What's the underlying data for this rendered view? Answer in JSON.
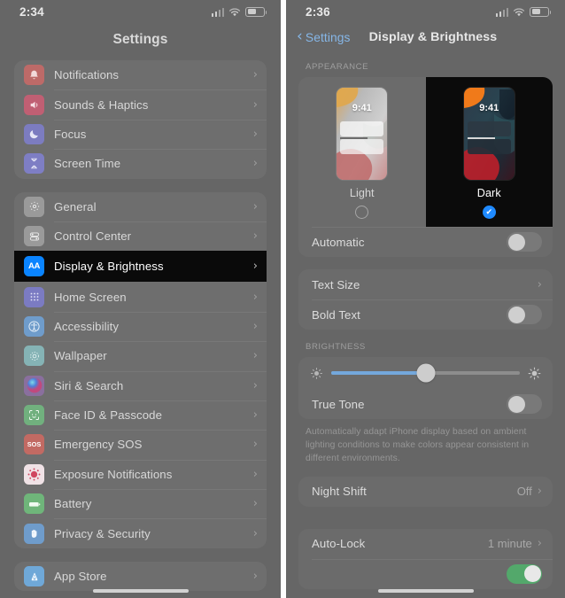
{
  "colors": {
    "panel_bg": "#666666",
    "card_bg": "#6e6e6e",
    "selected_row_bg": "#0a0a0a",
    "accent_blue": "#1f8aff",
    "link_blue": "#86b7e8",
    "slider_fill": "#74a8dc",
    "toggle_on_green": "#53a86b"
  },
  "left_panel": {
    "status_bar": {
      "time": "2:34",
      "cellular": "signal-bars-icon",
      "wifi": "wifi-icon",
      "battery": "battery-icon"
    },
    "title": "Settings",
    "groups": [
      {
        "items": [
          {
            "label": "Notifications",
            "icon": "notifications-icon",
            "icon_bg": "#bd6a68",
            "glyph": "🔔",
            "chevron": "›"
          },
          {
            "label": "Sounds & Haptics",
            "icon": "sounds-icon",
            "icon_bg": "#c05f73",
            "glyph": "🔊",
            "chevron": "›"
          },
          {
            "label": "Focus",
            "icon": "focus-icon",
            "icon_bg": "#7c7cc0",
            "glyph": "🌙",
            "chevron": "›"
          },
          {
            "label": "Screen Time",
            "icon": "screen-time-icon",
            "icon_bg": "#7e7ec4",
            "glyph": "⌛",
            "chevron": "›"
          }
        ]
      },
      {
        "items": [
          {
            "label": "General",
            "icon": "general-gear-icon",
            "icon_bg": "#9a9a9a",
            "glyph": "⚙",
            "chevron": "›",
            "selected": false
          },
          {
            "label": "Control Center",
            "icon": "control-center-icon",
            "icon_bg": "#9a9a9a",
            "glyph": "▤",
            "chevron": "›",
            "selected": false
          },
          {
            "label": "Display & Brightness",
            "icon": "display-brightness-icon",
            "icon_bg": "#0a84ff",
            "glyph": "AA",
            "chevron": "›",
            "selected": true
          },
          {
            "label": "Home Screen",
            "icon": "home-screen-icon",
            "icon_bg": "#7b7bc2",
            "glyph": "∷",
            "chevron": "›",
            "selected": false
          },
          {
            "label": "Accessibility",
            "icon": "accessibility-icon",
            "icon_bg": "#6f9ccb",
            "glyph": "♿",
            "chevron": "›",
            "selected": false
          },
          {
            "label": "Wallpaper",
            "icon": "wallpaper-icon",
            "icon_bg": "#85b3b5",
            "glyph": "❄",
            "chevron": "›",
            "selected": false
          },
          {
            "label": "Siri & Search",
            "icon": "siri-icon",
            "icon_bg": "#8a6f9e",
            "glyph": "◉",
            "chevron": "›",
            "selected": false
          },
          {
            "label": "Face ID & Passcode",
            "icon": "face-id-icon",
            "icon_bg": "#71b07e",
            "glyph": "☺",
            "chevron": "›",
            "selected": false
          },
          {
            "label": "Emergency SOS",
            "icon": "emergency-sos-icon",
            "icon_bg": "#c26a63",
            "glyph": "SOS",
            "chevron": "›",
            "selected": false
          },
          {
            "label": "Exposure Notifications",
            "icon": "exposure-notifications-icon",
            "icon_bg": "#c76f85",
            "glyph": "●",
            "chevron": "›",
            "selected": false
          },
          {
            "label": "Battery",
            "icon": "battery-settings-icon",
            "icon_bg": "#6fb57a",
            "glyph": "▬",
            "chevron": "›",
            "selected": false
          },
          {
            "label": "Privacy & Security",
            "icon": "privacy-security-icon",
            "icon_bg": "#6f9ccb",
            "glyph": "✋",
            "chevron": "›",
            "selected": false
          }
        ]
      },
      {
        "items": [
          {
            "label": "App Store",
            "icon": "app-store-icon",
            "icon_bg": "#6fa8d8",
            "glyph": "A",
            "chevron": "›"
          }
        ]
      }
    ]
  },
  "right_panel": {
    "status_bar": {
      "time": "2:36",
      "cellular": "signal-bars-icon",
      "wifi": "wifi-icon",
      "battery": "battery-icon"
    },
    "back_label": "Settings",
    "title": "Display & Brightness",
    "appearance": {
      "section_label": "APPEARANCE",
      "options": [
        {
          "name": "Light",
          "preview_time": "9:41",
          "selected": false
        },
        {
          "name": "Dark",
          "preview_time": "9:41",
          "selected": true
        }
      ],
      "check_glyph": "✔",
      "automatic": {
        "label": "Automatic",
        "enabled": false
      }
    },
    "text_group": [
      {
        "label": "Text Size",
        "type": "link",
        "chevron": "›"
      },
      {
        "label": "Bold Text",
        "type": "toggle",
        "enabled": false
      }
    ],
    "brightness": {
      "section_label": "BRIGHTNESS",
      "slider_percent": 50,
      "low_icon": "brightness-low-icon",
      "high_icon": "brightness-high-icon",
      "true_tone": {
        "label": "True Tone",
        "enabled": false
      },
      "footnote": "Automatically adapt iPhone display based on ambient lighting conditions to make colors appear consistent in different environments."
    },
    "night_shift": {
      "label": "Night Shift",
      "value": "Off",
      "chevron": "›"
    },
    "auto_lock": {
      "label": "Auto-Lock",
      "value": "1 minute",
      "chevron": "›"
    }
  }
}
